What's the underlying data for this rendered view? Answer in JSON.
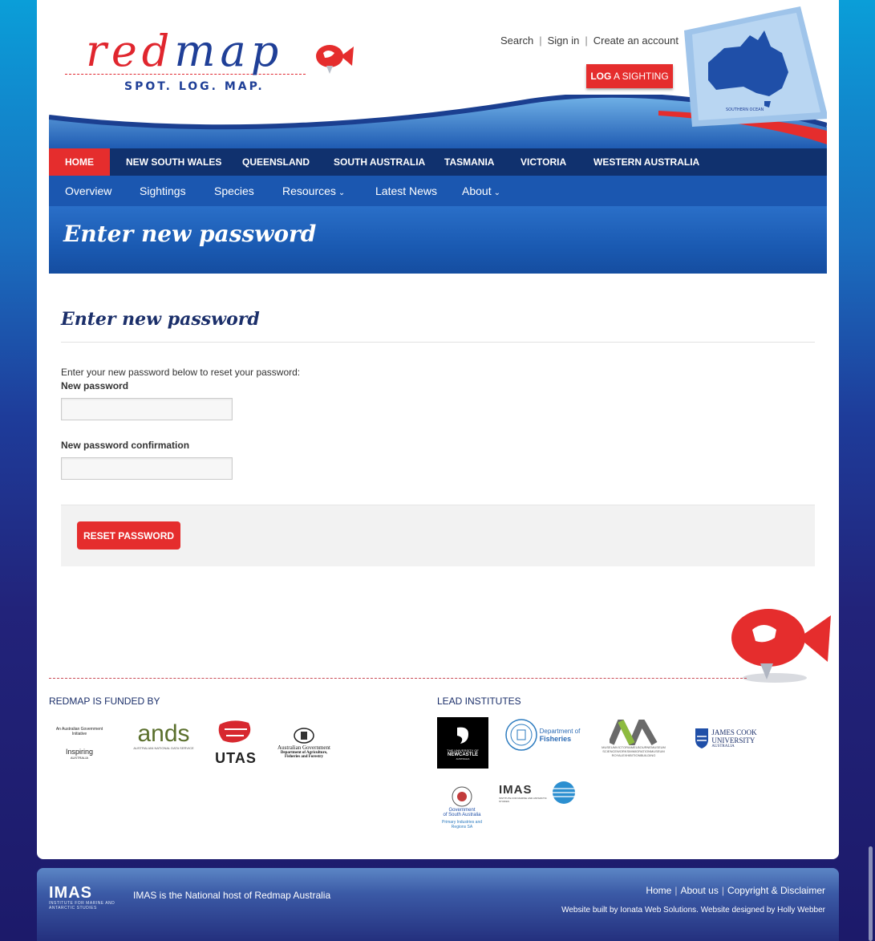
{
  "header": {
    "logo_word_red": "red",
    "logo_word_blue": "map",
    "logo_tagline": "SPOT. LOG. MAP.",
    "top_links": [
      "Search",
      "Sign in",
      "Create an account"
    ],
    "log_button_bold": "LOG",
    "log_button_rest": " A SIGHTING"
  },
  "nav_states": {
    "items": [
      "HOME",
      "NEW SOUTH WALES",
      "QUEENSLAND",
      "SOUTH AUSTRALIA",
      "TASMANIA",
      "VICTORIA",
      "WESTERN AUSTRALIA"
    ],
    "active": "HOME"
  },
  "nav_sub": {
    "items": [
      "Overview",
      "Sightings",
      "Species",
      "Resources",
      "Latest News",
      "About"
    ]
  },
  "banner": {
    "title": "Enter new password"
  },
  "form": {
    "title": "Enter new password",
    "intro": "Enter your new password below to reset your password:",
    "new_password_label": "New password",
    "new_password_value": "",
    "confirm_label": "New password confirmation",
    "confirm_value": "",
    "submit_label": "RESET PASSWORD"
  },
  "footer": {
    "funded_heading": "REDMAP IS FUNDED BY",
    "institutes_heading": "LEAD INSTITUTES",
    "funders": [
      {
        "line1": "An Australian Government Initiative",
        "line2": "Inspiring",
        "line3": "AUSTRALIA"
      },
      {
        "name": "ands",
        "sub": "AUSTRALIAN NATIONAL DATA SERVICE"
      },
      {
        "name": "UTAS"
      },
      {
        "line1": "Australian Government",
        "line2": "Department of Agriculture,",
        "line3": "Fisheries and Forestry"
      }
    ],
    "institutes": [
      {
        "line1": "THE UNIVERSITY OF",
        "line2": "NEWCASTLE",
        "line3": "AUSTRALIA"
      },
      {
        "line1": "Department of",
        "line2": "Fisheries"
      },
      {
        "line1": "MUSEUMVICTORIAMELBOURNEMUSEUM",
        "line2": "SCIENCEWORKSIMMIGRATIONMUSEUM",
        "line3": "ROYALEXHIBITIONBUILDING"
      },
      {
        "line1": "JAMES COOK",
        "line2": "UNIVERSITY",
        "line3": "AUSTRALIA"
      },
      {
        "line1": "Government",
        "line2": "of South Australia",
        "line3": "Primary Industries and Regions SA"
      },
      {
        "name": "IMAS",
        "sub": "INSTITUTE FOR MARINE AND ANTARCTIC STUDIES"
      }
    ]
  },
  "bottom_bar": {
    "logo": "IMAS",
    "logo_sub": "INSTITUTE FOR MARINE AND ANTARCTIC STUDIES",
    "host_text": "IMAS is the National host of Redmap Australia",
    "links": [
      "Home",
      "About us",
      "Copyright & Disclaimer"
    ],
    "credit": "Website built by Ionata Web Solutions. Website designed by Holly Webber"
  },
  "colors": {
    "brand_red": "#e52d2d",
    "nav_dark": "#10316e",
    "nav_blue": "#1b57b0",
    "brand_blue": "#1f3f97"
  }
}
